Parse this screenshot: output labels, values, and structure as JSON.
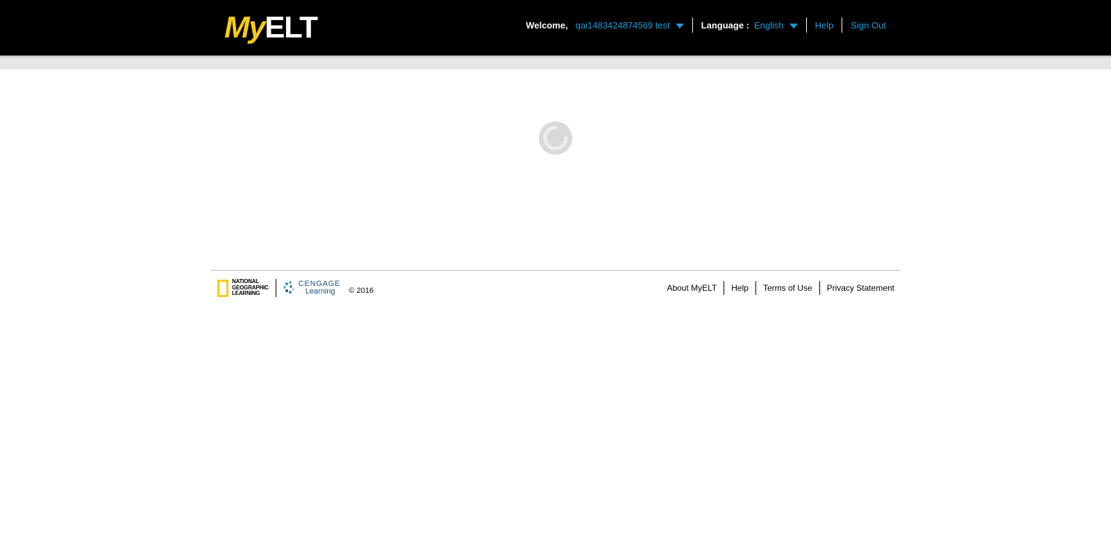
{
  "header": {
    "logo": {
      "my": "My",
      "elt": "ELT"
    },
    "welcome_label": "Welcome,",
    "username": "qai1483424874569 test",
    "language_label": "Language :",
    "language_value": "English",
    "help_label": "Help",
    "signout_label": "Sign Out"
  },
  "main": {
    "loading_icon": "loading-spinner-icon"
  },
  "footer": {
    "natgeo_logo": [
      "NATIONAL",
      "GEOGRAPHIC",
      "LEARNING"
    ],
    "cengage_logo": {
      "line1": "CENGAGE",
      "line2": "Learning"
    },
    "copyright": "© 2016",
    "links": {
      "about": "About MyELT",
      "help": "Help",
      "terms": "Terms of Use",
      "privacy": "Privacy Statement"
    }
  },
  "colors": {
    "header_bg": "#000000",
    "link_blue": "#1a9cdc",
    "logo_yellow": "#f7cb16"
  }
}
